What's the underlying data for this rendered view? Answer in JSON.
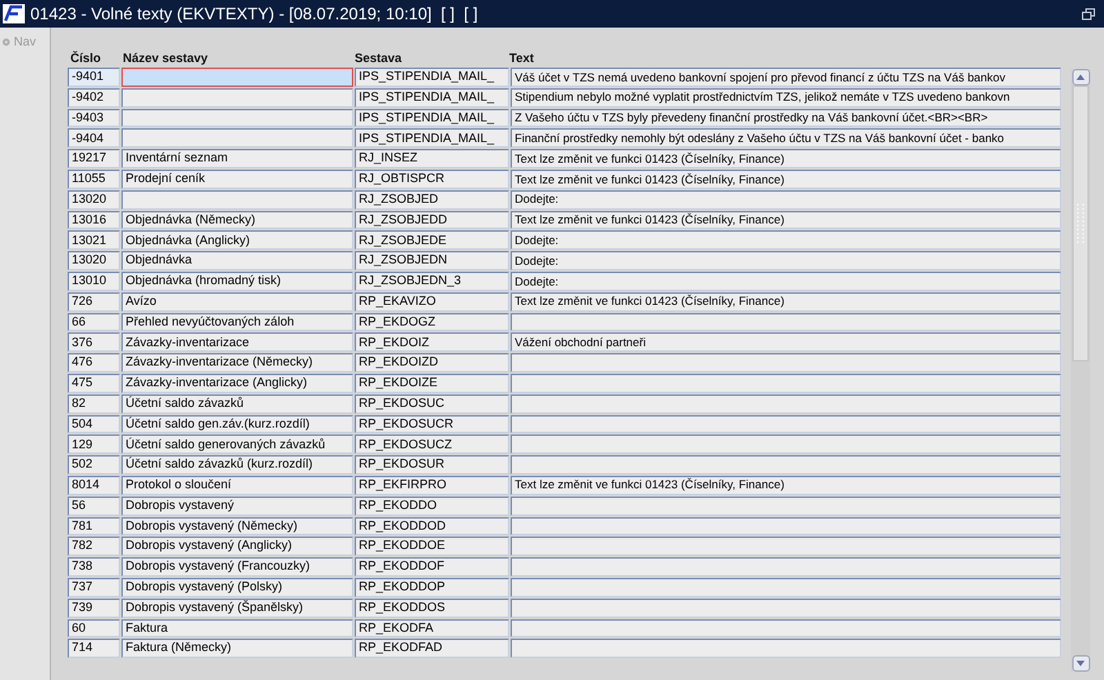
{
  "window": {
    "title": "01423 - Volné texty (EKVTEXTY) - [08.07.2019; 10:10]  [ ]  [ ]"
  },
  "sidebar": {
    "items": [
      {
        "label": "Nav"
      }
    ]
  },
  "table": {
    "columns": [
      "Číslo",
      "Název sestavy",
      "Sestava",
      "Text"
    ],
    "rows": [
      {
        "cells": [
          "-9401",
          "",
          "IPS_STIPENDIA_MAIL_",
          "Váš účet v TZS nemá uvedeno bankovní spojení pro převod financí z účtu TZS na Váš bankov"
        ],
        "selected": true
      },
      {
        "cells": [
          "-9402",
          "",
          "IPS_STIPENDIA_MAIL_",
          "Stipendium nebylo možné vyplatit prostřednictvím TZS, jelikož nemáte v TZS uvedeno bankovn"
        ],
        "selected": false
      },
      {
        "cells": [
          "-9403",
          "",
          "IPS_STIPENDIA_MAIL_",
          "Z Vašeho účtu v TZS byly převedeny finanční prostředky na Váš bankovní účet.<BR><BR>"
        ],
        "selected": false
      },
      {
        "cells": [
          "-9404",
          "",
          "IPS_STIPENDIA_MAIL_",
          "Finanční prostředky nemohly být odeslány z Vašeho účtu v TZS na Váš bankovní účet - banko"
        ],
        "selected": false
      },
      {
        "cells": [
          "19217",
          "Inventární seznam",
          "RJ_INSEZ",
          "Text lze změnit ve funkci 01423 (Číselníky, Finance)"
        ],
        "selected": false
      },
      {
        "cells": [
          "11055",
          "Prodejní ceník",
          "RJ_OBTISPCR",
          "Text lze změnit ve funkci 01423 (Číselníky, Finance)"
        ],
        "selected": false
      },
      {
        "cells": [
          "13020",
          "",
          "RJ_ZSOBJED",
          "Dodejte:"
        ],
        "selected": false
      },
      {
        "cells": [
          "13016",
          "Objednávka (Německy)",
          "RJ_ZSOBJEDD",
          "Text lze změnit ve funkci 01423 (Číselníky, Finance)"
        ],
        "selected": false
      },
      {
        "cells": [
          "13021",
          "Objednávka (Anglicky)",
          "RJ_ZSOBJEDE",
          "Dodejte:"
        ],
        "selected": false
      },
      {
        "cells": [
          "13020",
          "Objednávka",
          "RJ_ZSOBJEDN",
          "Dodejte:"
        ],
        "selected": false
      },
      {
        "cells": [
          "13010",
          "Objednávka  (hromadný tisk)",
          "RJ_ZSOBJEDN_3",
          "Dodejte:"
        ],
        "selected": false
      },
      {
        "cells": [
          "726",
          "Avízo",
          "RP_EKAVIZO",
          "Text lze změnit ve funkci 01423 (Číselníky, Finance)"
        ],
        "selected": false
      },
      {
        "cells": [
          "66",
          "Přehled nevyúčtovaných záloh",
          "RP_EKDOGZ",
          ""
        ],
        "selected": false
      },
      {
        "cells": [
          "376",
          "Závazky-inventarizace",
          "RP_EKDOIZ",
          "Vážení obchodní partneři"
        ],
        "selected": false
      },
      {
        "cells": [
          "476",
          "Závazky-inventarizace (Německy)",
          "RP_EKDOIZD",
          ""
        ],
        "selected": false
      },
      {
        "cells": [
          "475",
          "Závazky-inventarizace (Anglicky)",
          "RP_EKDOIZE",
          ""
        ],
        "selected": false
      },
      {
        "cells": [
          "82",
          "Účetní saldo závazků",
          "RP_EKDOSUC",
          ""
        ],
        "selected": false
      },
      {
        "cells": [
          "504",
          "Účetní saldo gen.záv.(kurz.rozdíl)",
          "RP_EKDOSUCR",
          ""
        ],
        "selected": false
      },
      {
        "cells": [
          "129",
          "Účetní saldo generovaných závazků",
          "RP_EKDOSUCZ",
          ""
        ],
        "selected": false
      },
      {
        "cells": [
          "502",
          "Účetní saldo závazků (kurz.rozdíl)",
          "RP_EKDOSUR",
          ""
        ],
        "selected": false
      },
      {
        "cells": [
          "8014",
          "Protokol o sloučení",
          "RP_EKFIRPRO",
          "Text lze změnit ve funkci 01423 (Číselníky, Finance)"
        ],
        "selected": false
      },
      {
        "cells": [
          "56",
          "Dobropis vystavený",
          "RP_EKODDO",
          ""
        ],
        "selected": false
      },
      {
        "cells": [
          "781",
          "Dobropis vystavený (Německy)",
          "RP_EKODDOD",
          ""
        ],
        "selected": false
      },
      {
        "cells": [
          "782",
          "Dobropis vystavený (Anglicky)",
          "RP_EKODDOE",
          ""
        ],
        "selected": false
      },
      {
        "cells": [
          "738",
          "Dobropis vystavený (Francouzky)",
          "RP_EKODDOF",
          ""
        ],
        "selected": false
      },
      {
        "cells": [
          "737",
          "Dobropis vystavený (Polsky)",
          "RP_EKODDOP",
          ""
        ],
        "selected": false
      },
      {
        "cells": [
          "739",
          "Dobropis vystavený (Španělsky)",
          "RP_EKODDOS",
          ""
        ],
        "selected": false
      },
      {
        "cells": [
          "60",
          "Faktura",
          "RP_EKODFA",
          ""
        ],
        "selected": false
      },
      {
        "cells": [
          "714",
          "Faktura (Německy)",
          "RP_EKODFAD",
          ""
        ],
        "selected": false
      }
    ]
  }
}
